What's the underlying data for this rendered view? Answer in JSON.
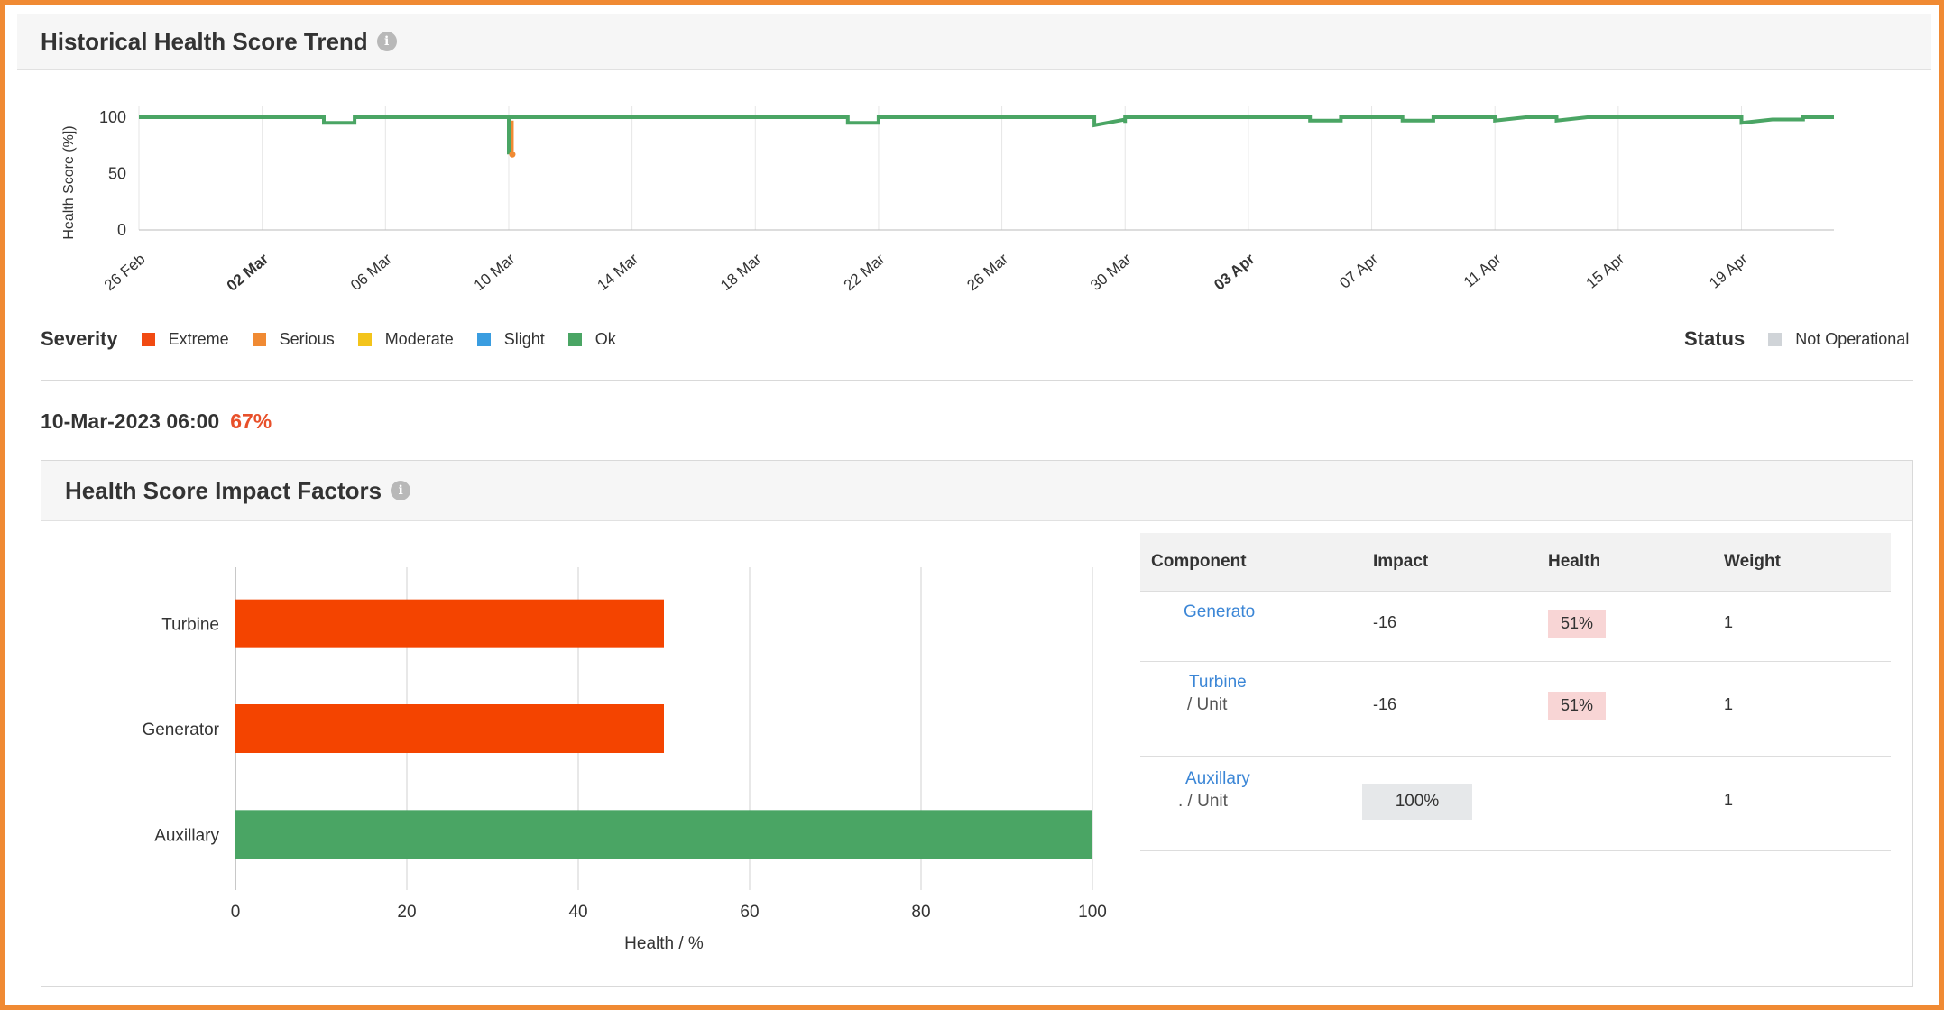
{
  "trend_card": {
    "title": "Historical Health Score Trend",
    "info_icon": "info-icon",
    "chart_data": {
      "type": "line",
      "ylabel": "Health Score (%])",
      "ylim": [
        0,
        100
      ],
      "yticks": [
        "0",
        "50",
        "100"
      ],
      "xticks": [
        "26 Feb",
        "02 Mar",
        "06 Mar",
        "10 Mar",
        "14 Mar",
        "18 Mar",
        "22 Mar",
        "26 Mar",
        "30 Mar",
        "03 Apr",
        "07 Apr",
        "11 Apr",
        "15 Apr",
        "19 Apr"
      ],
      "x_start": "26 Feb",
      "x_end": "22 Apr",
      "series_color": "#4aa564",
      "points": [
        [
          "26 Feb",
          100
        ],
        [
          "04 Mar",
          100
        ],
        [
          "04 Mar",
          95
        ],
        [
          "05 Mar",
          95
        ],
        [
          "05 Mar",
          100
        ],
        [
          "10 Mar",
          100
        ],
        [
          "10 Mar",
          67
        ],
        [
          "10 Mar",
          92
        ],
        [
          "10 Mar",
          100
        ],
        [
          "21 Mar",
          100
        ],
        [
          "21 Mar",
          95
        ],
        [
          "22 Mar",
          95
        ],
        [
          "22 Mar",
          100
        ],
        [
          "29 Mar",
          100
        ],
        [
          "29 Mar",
          93
        ],
        [
          "30 Mar",
          98
        ],
        [
          "30 Mar",
          95
        ],
        [
          "30 Mar",
          100
        ],
        [
          "05 Apr",
          100
        ],
        [
          "05 Apr",
          97
        ],
        [
          "06 Apr",
          97
        ],
        [
          "06 Apr",
          100
        ],
        [
          "08 Apr",
          100
        ],
        [
          "08 Apr",
          97
        ],
        [
          "09 Apr",
          97
        ],
        [
          "09 Apr",
          100
        ],
        [
          "11 Apr",
          100
        ],
        [
          "11 Apr",
          97
        ],
        [
          "12 Apr",
          100
        ],
        [
          "13 Apr",
          100
        ],
        [
          "13 Apr",
          97
        ],
        [
          "14 Apr",
          100
        ],
        [
          "19 Apr",
          100
        ],
        [
          "19 Apr",
          95
        ],
        [
          "20 Apr",
          98
        ],
        [
          "21 Apr",
          98
        ],
        [
          "21 Apr",
          100
        ],
        [
          "22 Apr",
          100
        ]
      ],
      "highlight": {
        "x": "10 Mar",
        "y": 67,
        "severity": "Serious",
        "color": "#f08a33"
      }
    },
    "severity_legend": {
      "label": "Severity",
      "items": [
        {
          "label": "Extreme",
          "color": "#f14a12"
        },
        {
          "label": "Serious",
          "color": "#f08a33"
        },
        {
          "label": "Moderate",
          "color": "#f3c41b"
        },
        {
          "label": "Slight",
          "color": "#3a9de0"
        },
        {
          "label": "Ok",
          "color": "#4aa564"
        }
      ]
    },
    "status_legend": {
      "label": "Status",
      "items": [
        {
          "label": "Not Operational",
          "color": "#d0d4d8"
        }
      ]
    }
  },
  "selected_point": {
    "timestamp": "10-Mar-2023 06:00",
    "value": "67%",
    "value_color": "#e8502a"
  },
  "impact_card": {
    "title": "Health Score Impact Factors",
    "info_icon": "info-icon",
    "chart_data": {
      "type": "bar",
      "orientation": "horizontal",
      "categories": [
        "Turbine",
        "Generator",
        "Auxillary"
      ],
      "values": [
        50,
        50,
        100
      ],
      "colors": [
        "#f44400",
        "#f44400",
        "#4aa564"
      ],
      "xlabel": "Health / %",
      "xlim": [
        0,
        100
      ],
      "xticks": [
        "0",
        "20",
        "40",
        "60",
        "80",
        "100"
      ]
    },
    "table": {
      "headers": [
        "Component",
        "Impact",
        "Health",
        "Weight"
      ],
      "rows": [
        {
          "component": "Generato",
          "sub": "",
          "impact": "-16",
          "health": "51%",
          "weight": "1"
        },
        {
          "component": "Turbine",
          "sub": "/ Unit",
          "impact": "-16",
          "health": "51%",
          "weight": "1"
        },
        {
          "component": "Auxillary",
          "sub": ". / Unit",
          "impact": "100%",
          "health": "",
          "weight": "1"
        }
      ]
    }
  }
}
